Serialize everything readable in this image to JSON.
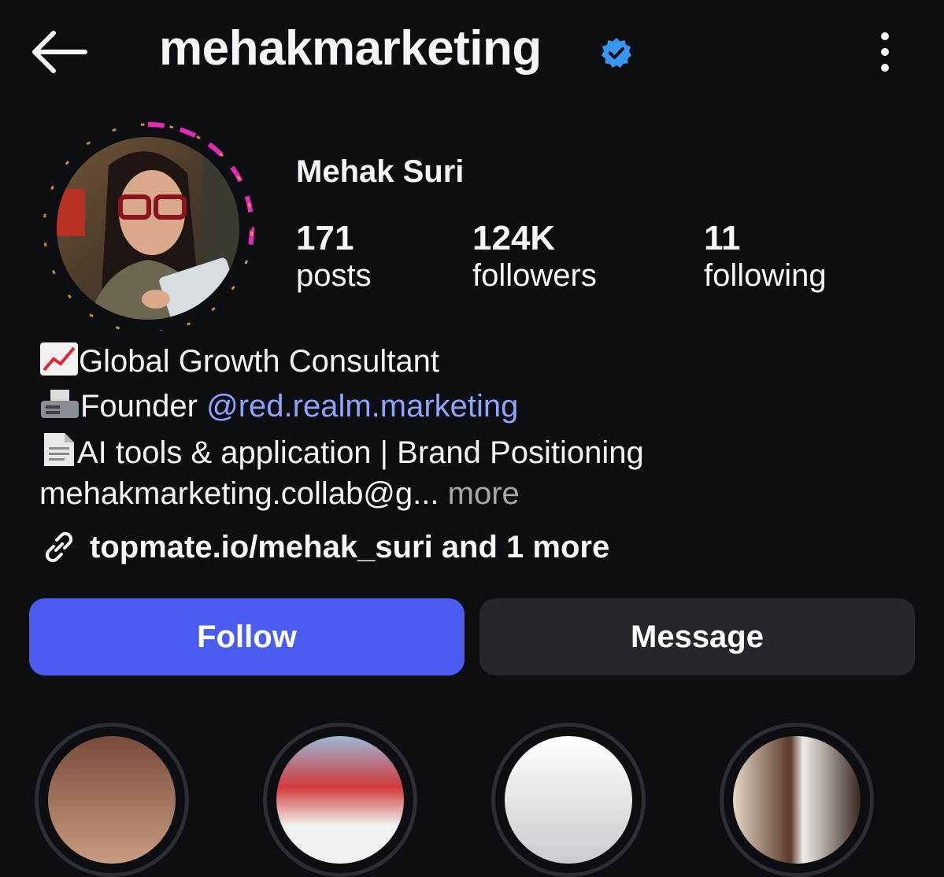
{
  "header": {
    "username": "mehakmarketing",
    "icons": [
      "back-arrow-icon",
      "verified-badge-icon",
      "more-options-icon"
    ],
    "accent": "#3897f0"
  },
  "profile": {
    "display_name": "Mehak Suri",
    "stats": [
      {
        "value": "171",
        "label": "posts"
      },
      {
        "value": "124K",
        "label": "followers"
      },
      {
        "value": "11",
        "label": "following"
      }
    ]
  },
  "bio": {
    "line1": "Global Growth Consultant",
    "line1_icon": "chart-increasing-icon",
    "line2_prefix": "Founder ",
    "line2_mention": "@red.realm.marketing",
    "line2_icon": "fax-machine-icon",
    "line3": "AI tools & application | Brand Positioning",
    "line3_icon": "document-icon",
    "line4": "mehakmarketing.collab@g...",
    "line4_more": "more",
    "link_text": "topmate.io/mehak_suri and 1 more",
    "link_icon": "link-icon"
  },
  "actions": {
    "follow_label": "Follow",
    "message_label": "Message",
    "follow_color": "#4a5df0",
    "message_color": "#25272c"
  }
}
